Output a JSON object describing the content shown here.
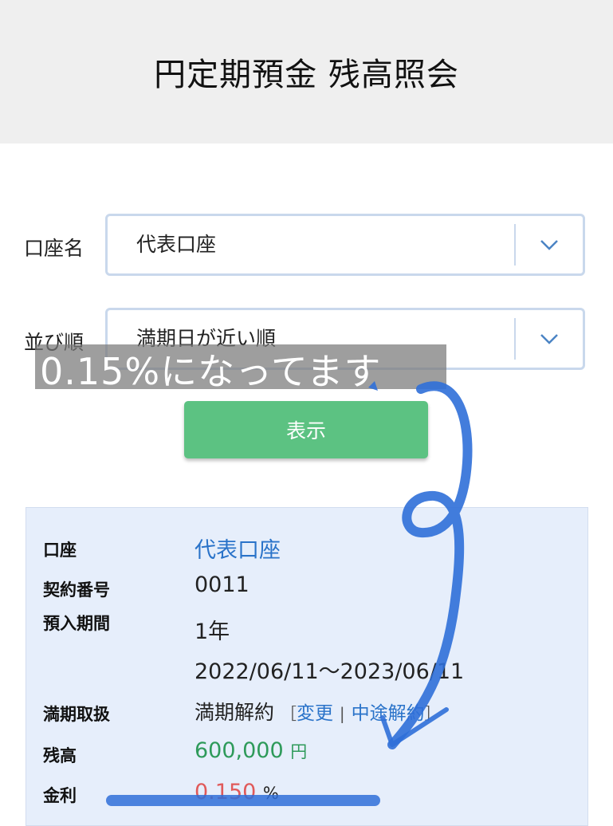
{
  "header": {
    "title": "円定期預金 残高照会"
  },
  "form": {
    "account_label": "口座名",
    "account_value": "代表口座",
    "sort_label": "並び順",
    "sort_value": "満期日が近い順",
    "submit_label": "表示"
  },
  "annotation": {
    "text": "0.15%になってます"
  },
  "details": {
    "account": {
      "label": "口座",
      "value": "代表口座"
    },
    "contract": {
      "label": "契約番号",
      "value": "0011"
    },
    "period": {
      "label": "預入期間",
      "value": "1年",
      "range": "2022/06/11〜2023/06/11"
    },
    "maturity": {
      "label": "満期取扱",
      "value": "満期解約",
      "bracket_open": "［",
      "change_link": "変更",
      "divider": "|",
      "cancel_link": "中途解約",
      "bracket_close": "］"
    },
    "balance": {
      "label": "残高",
      "value": "600,000",
      "unit": "円"
    },
    "rate": {
      "label": "金利",
      "value": "0.150",
      "unit": "%"
    }
  },
  "colors": {
    "header_bg": "#efefef",
    "button_green": "#5cc282",
    "panel_bg": "#e6eefb",
    "link_blue": "#2a73c9",
    "amount_green": "#2e9a5a",
    "rate_red": "#e05a5a",
    "ink_blue": "#2f6fd8"
  },
  "icons": {
    "select_chevron": "chevron-down-icon"
  }
}
